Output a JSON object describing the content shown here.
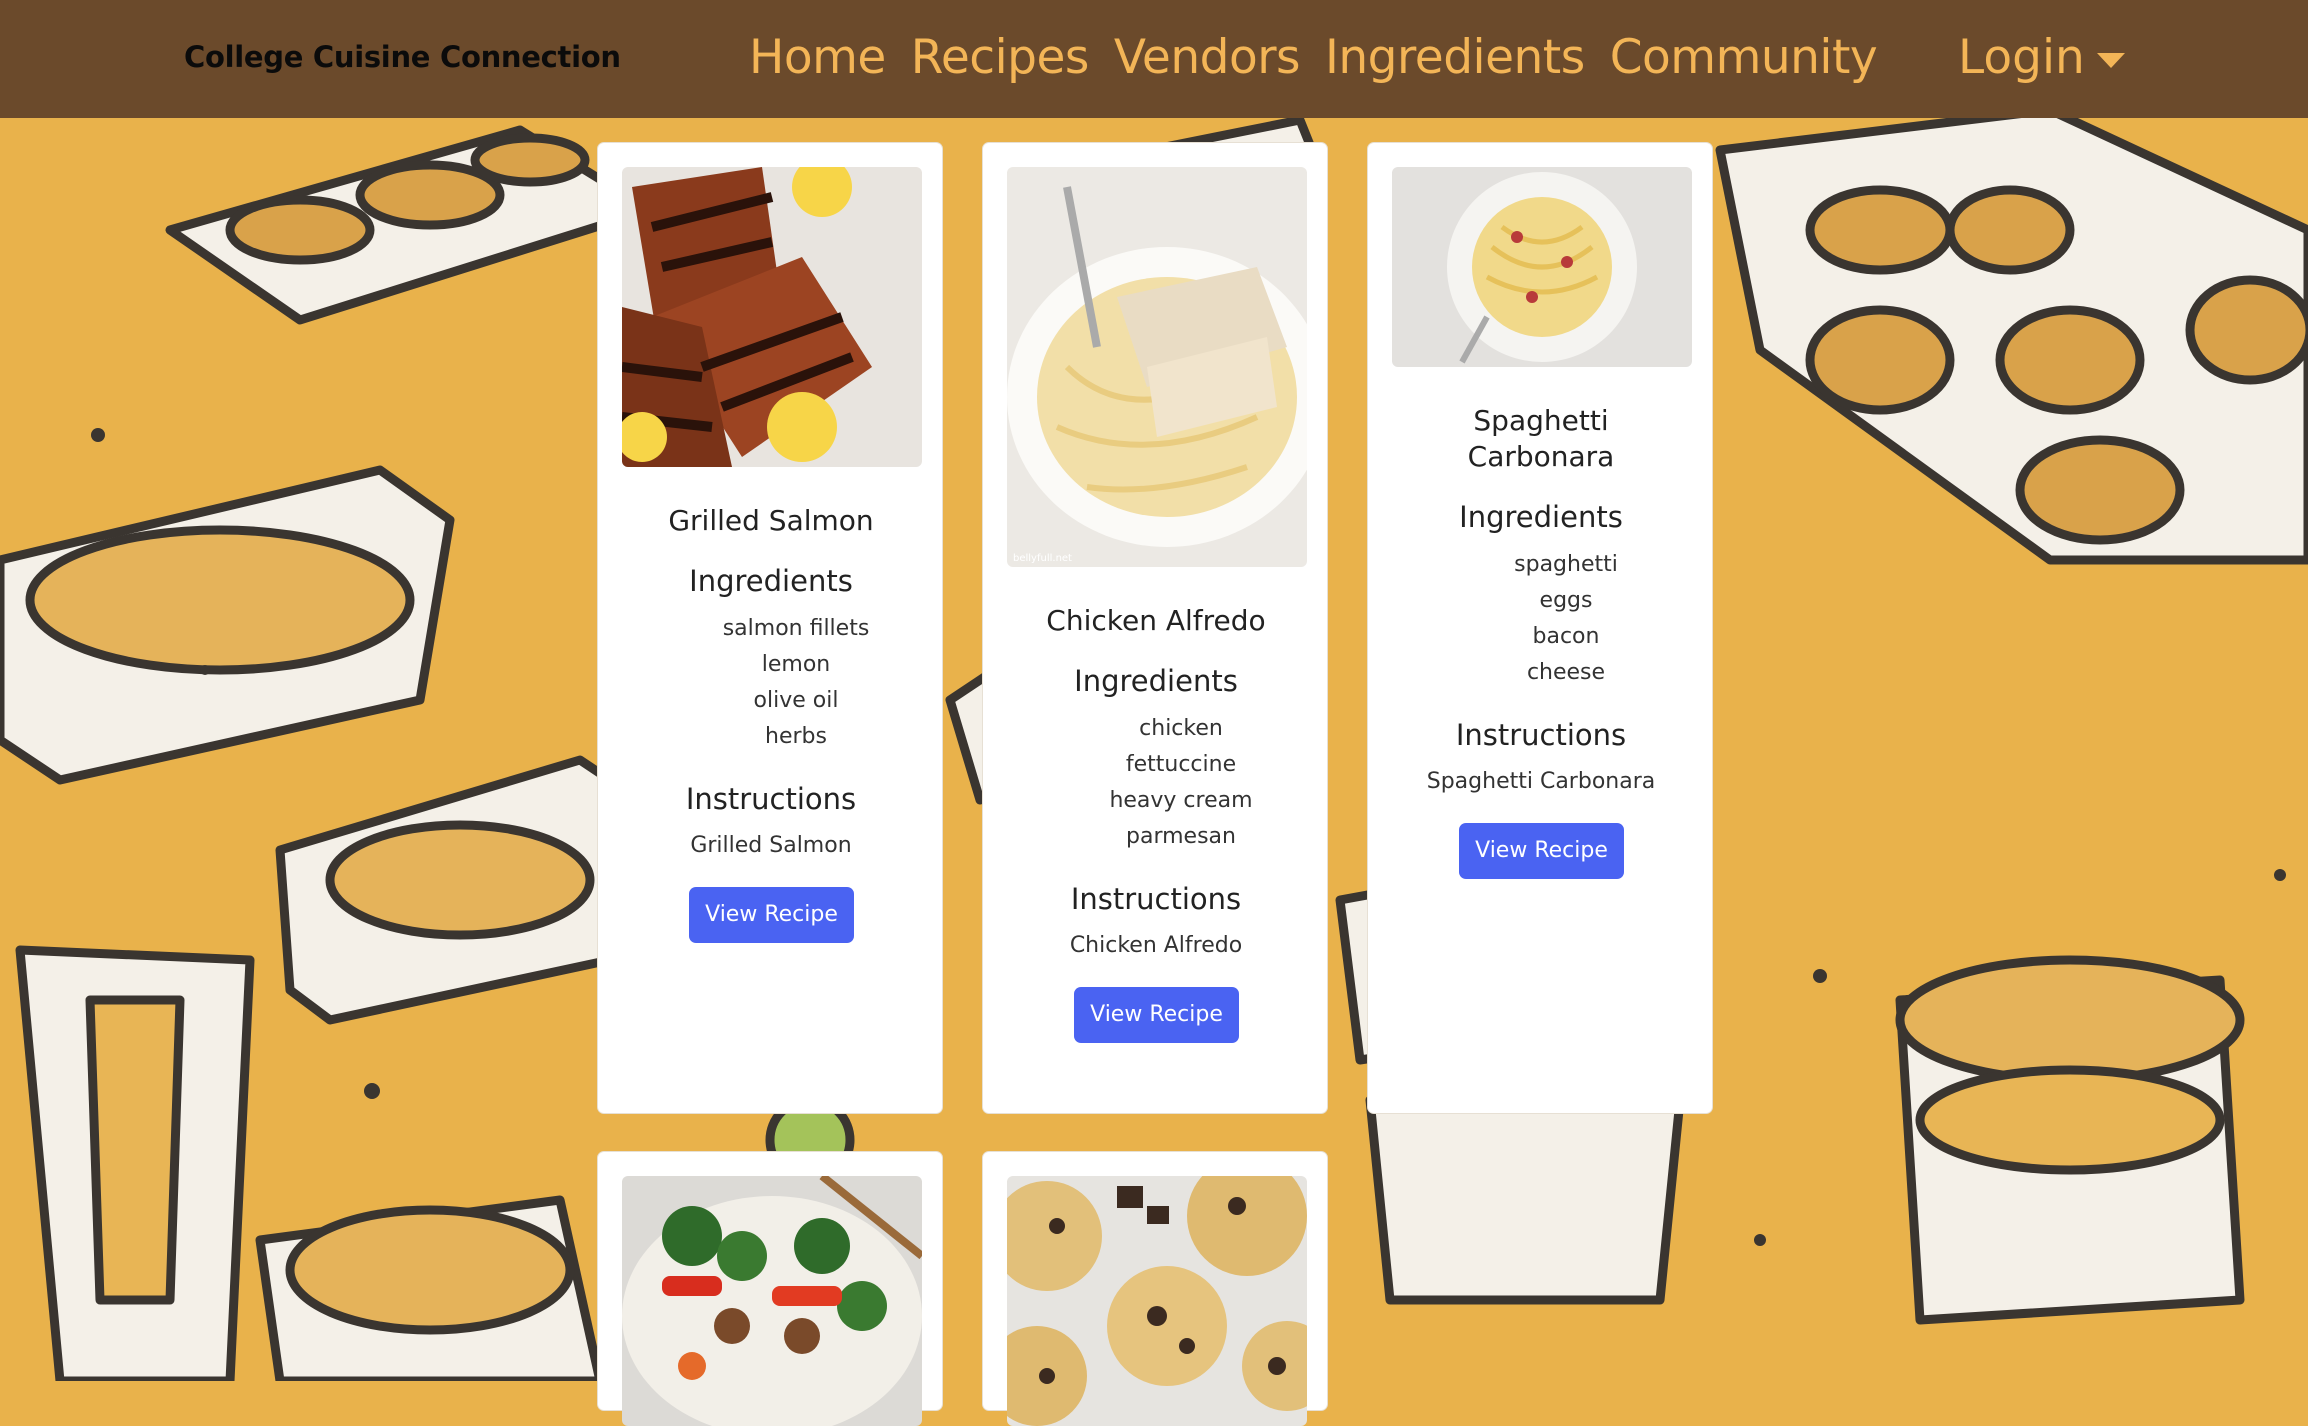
{
  "navbar": {
    "brand": "College Cuisine Connection",
    "links": [
      "Home",
      "Recipes",
      "Vendors",
      "Ingredients",
      "Community"
    ],
    "login": "Login"
  },
  "recipes": [
    {
      "title": "Grilled Salmon",
      "ingredients_heading": "Ingredients",
      "ingredients": [
        "salmon fillets",
        "lemon",
        "olive oil",
        "herbs"
      ],
      "instructions_heading": "Instructions",
      "instructions": "Grilled Salmon",
      "button": "View Recipe"
    },
    {
      "title": "Chicken Alfredo",
      "ingredients_heading": "Ingredients",
      "ingredients": [
        "chicken",
        "fettuccine",
        "heavy cream",
        "parmesan"
      ],
      "instructions_heading": "Instructions",
      "instructions": "Chicken Alfredo",
      "button": "View Recipe",
      "image_watermark": "bellyfull.net"
    },
    {
      "title_lines": [
        "Spaghetti",
        "Carbonara"
      ],
      "ingredients_heading": "Ingredients",
      "ingredients": [
        "spaghetti",
        "eggs",
        "bacon",
        "cheese"
      ],
      "instructions_heading": "Instructions",
      "instructions": "Spaghetti Carbonara",
      "button": "View Recipe"
    }
  ],
  "partial_cards": [
    {
      "image": "stir-fry-photo"
    },
    {
      "image": "chocolate-chip-cookies-photo"
    }
  ],
  "colors": {
    "navbar_bg": "#6b4a2b",
    "nav_link": "#f3b557",
    "background": "#e9b24b",
    "button": "#4a63f2"
  }
}
